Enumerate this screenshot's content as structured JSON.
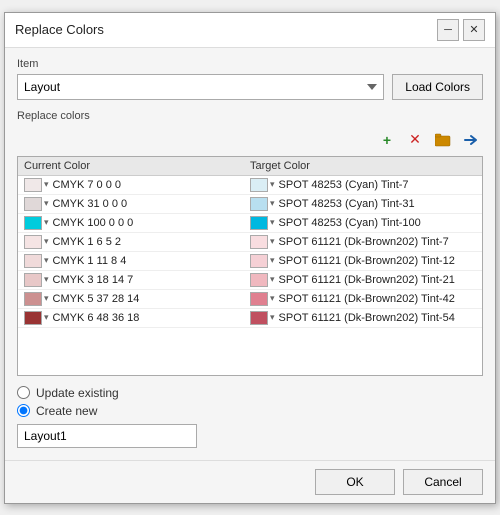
{
  "dialog": {
    "title": "Replace Colors",
    "title_btn_minimize": "─",
    "title_btn_close": "✕"
  },
  "item_section": {
    "label": "Item",
    "select_value": "Layout",
    "select_options": [
      "Layout"
    ]
  },
  "load_colors_btn": "Load Colors",
  "replace_colors_label": "Replace colors",
  "toolbar": {
    "add": "+",
    "remove": "✕",
    "folder": "📁",
    "arrow": "→"
  },
  "table": {
    "header_current": "Current Color",
    "header_target": "Target Color",
    "rows": [
      {
        "current_color": "#f0e8e8",
        "current_name": "CMYK 7 0 0 0",
        "target_color": "#daeef5",
        "target_name": "SPOT 48253 (Cyan) Tint-7"
      },
      {
        "current_color": "#e0d8d8",
        "current_name": "CMYK 31 0 0 0",
        "target_color": "#b8dff0",
        "target_name": "SPOT 48253 (Cyan) Tint-31"
      },
      {
        "current_color": "#00ccdd",
        "current_name": "CMYK 100 0 0 0",
        "target_color": "#00b8e0",
        "target_name": "SPOT 48253 (Cyan) Tint-100"
      },
      {
        "current_color": "#f5e4e4",
        "current_name": "CMYK 1 6 5 2",
        "target_color": "#f8dde0",
        "target_name": "SPOT 61121 (Dk-Brown202) Tint-7"
      },
      {
        "current_color": "#f0dada",
        "current_name": "CMYK 1 11 8 4",
        "target_color": "#f5d0d5",
        "target_name": "SPOT 61121 (Dk-Brown202) Tint-12"
      },
      {
        "current_color": "#e8c8c8",
        "current_name": "CMYK 3 18 14 7",
        "target_color": "#f0b8bf",
        "target_name": "SPOT 61121 (Dk-Brown202) Tint-21"
      },
      {
        "current_color": "#cc9090",
        "current_name": "CMYK 5 37 28 14",
        "target_color": "#e08090",
        "target_name": "SPOT 61121 (Dk-Brown202) Tint-42"
      },
      {
        "current_color": "#993333",
        "current_name": "CMYK 6 48 36 18",
        "target_color": "#c05060",
        "target_name": "SPOT 61121 (Dk-Brown202) Tint-54"
      }
    ]
  },
  "radio": {
    "update_existing": "Update existing",
    "create_new": "Create new",
    "selected": "create_new"
  },
  "new_name_input": {
    "value": "Layout1",
    "placeholder": ""
  },
  "footer": {
    "ok": "OK",
    "cancel": "Cancel"
  }
}
